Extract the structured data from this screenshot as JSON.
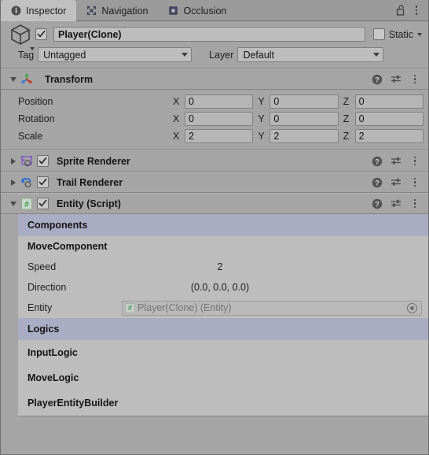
{
  "window": {
    "tabs": [
      {
        "label": "Inspector",
        "icon": "info-circle-icon",
        "active": true
      },
      {
        "label": "Navigation",
        "icon": "navigation-arrows-icon",
        "active": false
      },
      {
        "label": "Occlusion",
        "icon": "occlusion-square-icon",
        "active": false
      }
    ],
    "lock_icon": "unlocked-padlock-icon",
    "menu_icon": "kebab-menu-icon"
  },
  "gameobject": {
    "icon": "cube-icon",
    "enabled": true,
    "name": "Player(Clone)",
    "static_label": "Static",
    "static_checked": false,
    "tag_label": "Tag",
    "tag_value": "Untagged",
    "layer_label": "Layer",
    "layer_value": "Default"
  },
  "components": [
    {
      "name": "Transform",
      "icon": "transform-axis-icon",
      "expanded": true,
      "has_enable_toggle": false
    },
    {
      "name": "Sprite Renderer",
      "icon": "sprite-renderer-icon",
      "expanded": false,
      "has_enable_toggle": true,
      "enabled": true
    },
    {
      "name": "Trail Renderer",
      "icon": "trail-renderer-icon",
      "expanded": false,
      "has_enable_toggle": true,
      "enabled": true
    },
    {
      "name": "Entity (Script)",
      "icon": "csharp-script-icon",
      "expanded": true,
      "has_enable_toggle": true,
      "enabled": true
    }
  ],
  "transform": {
    "rows": [
      {
        "label": "Position",
        "x": "0",
        "y": "0",
        "z": "0"
      },
      {
        "label": "Rotation",
        "x": "0",
        "y": "0",
        "z": "0"
      },
      {
        "label": "Scale",
        "x": "2",
        "y": "2",
        "z": "2"
      }
    ],
    "axis_labels": {
      "x": "X",
      "y": "Y",
      "z": "Z"
    }
  },
  "entity_script": {
    "components_band": "Components",
    "move_component": {
      "title": "MoveComponent",
      "speed_label": "Speed",
      "speed_value": "2",
      "direction_label": "Direction",
      "direction_value": "(0.0, 0.0, 0.0)",
      "entity_label": "Entity",
      "entity_value": "Player(Clone) (Entity)",
      "entity_icon": "csharp-script-mini-icon",
      "entity_picker_icon": "object-picker-icon"
    },
    "logics_band": "Logics",
    "logics": [
      {
        "label": "InputLogic"
      },
      {
        "label": "MoveLogic"
      },
      {
        "label": "PlayerEntityBuilder"
      }
    ]
  },
  "colors": {
    "panel_bg": "#a5a5a5",
    "tab_active_bg": "#c0c0c0",
    "script_body_bg": "#bdbdbd",
    "section_band": "#a9adc4",
    "field_bg": "#b6b6b6",
    "border": "#6e6e6e"
  },
  "icon_glyphs": {
    "help": "?",
    "hash": "#"
  }
}
